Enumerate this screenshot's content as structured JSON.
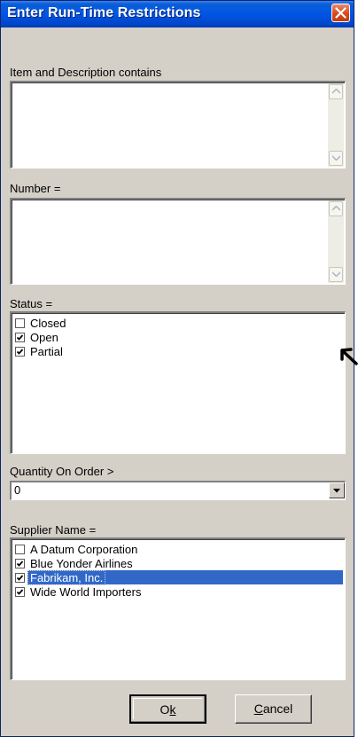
{
  "window": {
    "title": "Enter Run-Time Restrictions"
  },
  "fields": {
    "item_label": "Item and Description contains",
    "item_value": "",
    "number_label": "Number =",
    "number_value": "",
    "status_label": "Status =",
    "status_options": [
      {
        "label": "Closed",
        "checked": false
      },
      {
        "label": "Open",
        "checked": true
      },
      {
        "label": "Partial",
        "checked": true
      }
    ],
    "quantity_label": "Quantity On Order >",
    "quantity_value": "0",
    "supplier_label": "Supplier Name =",
    "supplier_options": [
      {
        "label": "A Datum Corporation",
        "checked": false
      },
      {
        "label": "Blue Yonder Airlines",
        "checked": true
      },
      {
        "label": "Fabrikam, Inc.",
        "checked": true,
        "selected": true
      },
      {
        "label": "Wide World Importers",
        "checked": true
      }
    ]
  },
  "buttons": {
    "ok_pre": "O",
    "ok_mn": "k",
    "cancel_mn": "C",
    "cancel_post": "ancel"
  },
  "colors": {
    "title_bar": "#0055e5",
    "dialog_bg": "#d4d0c8",
    "selection": "#3168c8"
  },
  "icons": [
    "close-icon",
    "scroll-up-arrow-icon",
    "scroll-down-arrow-icon",
    "checkmark-icon",
    "dropdown-arrow-icon",
    "arrow-pointer-icon"
  ]
}
